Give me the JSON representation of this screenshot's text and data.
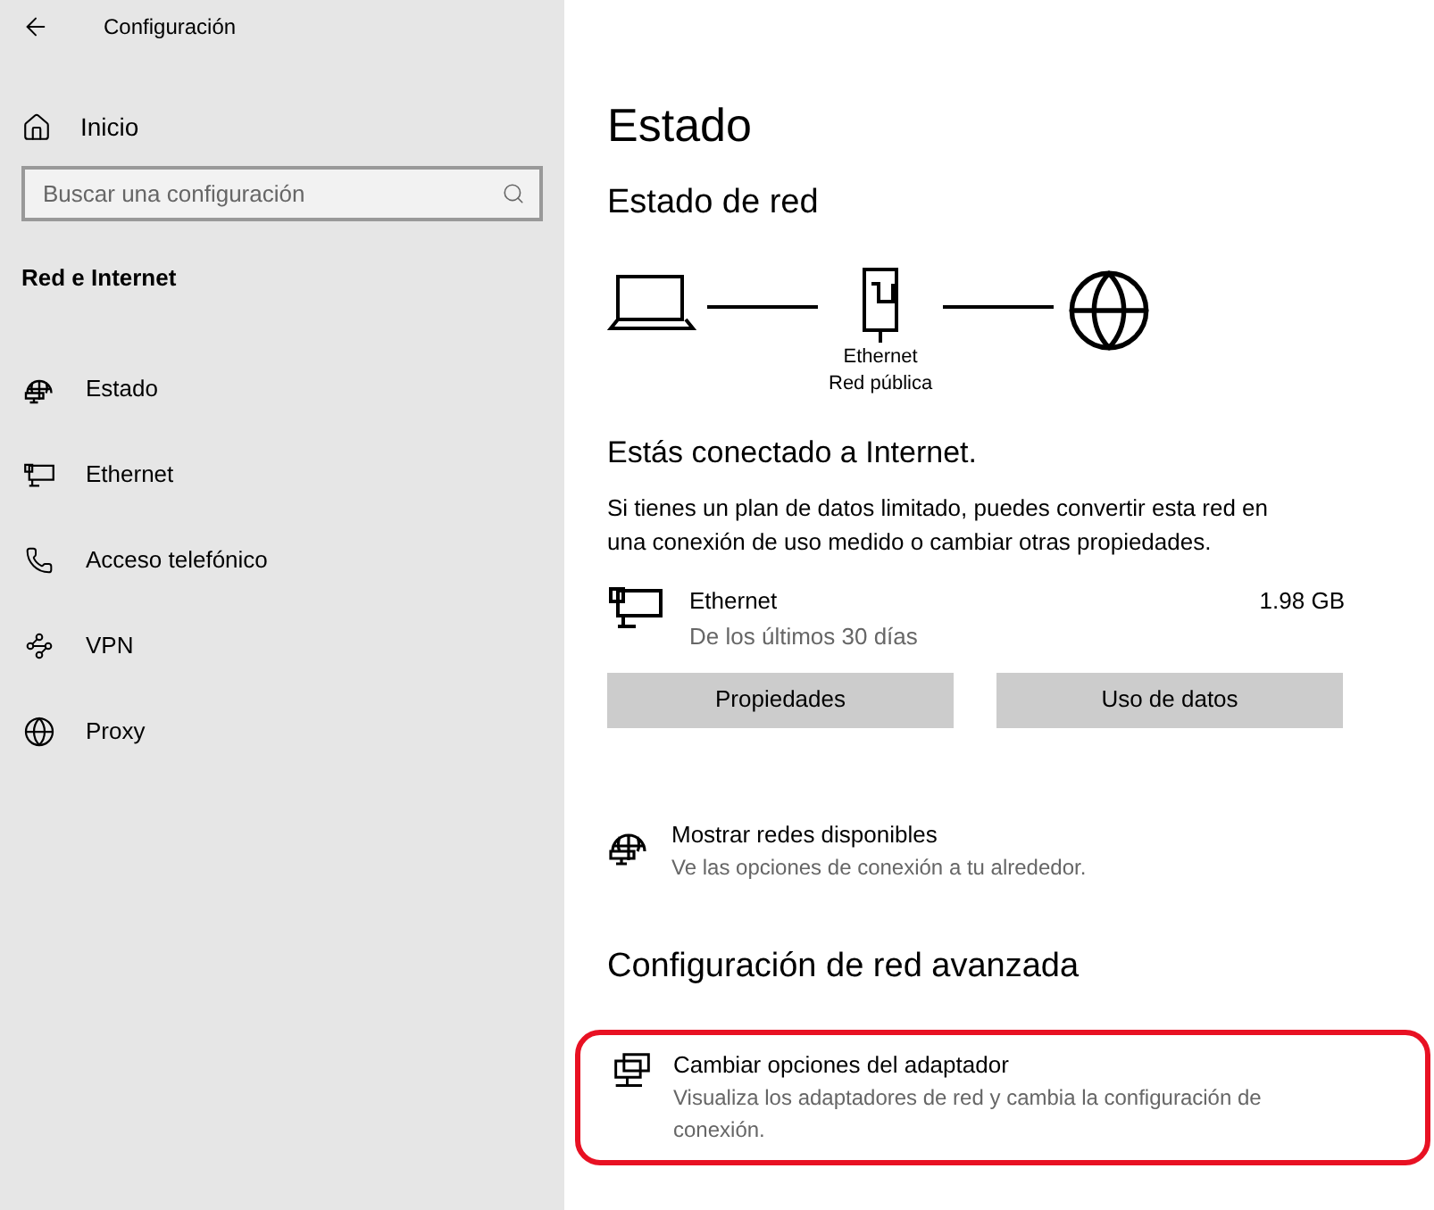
{
  "window": {
    "title": "Configuración"
  },
  "sidebar": {
    "home": "Inicio",
    "search": {
      "placeholder": "Buscar una configuración"
    },
    "section": "Red e Internet",
    "items": [
      {
        "kind": "status",
        "label": "Estado"
      },
      {
        "kind": "ethernet",
        "label": "Ethernet"
      },
      {
        "kind": "dialup",
        "label": "Acceso telefónico"
      },
      {
        "kind": "vpn",
        "label": "VPN"
      },
      {
        "kind": "proxy",
        "label": "Proxy"
      }
    ]
  },
  "main": {
    "title": "Estado",
    "network_heading": "Estado de red",
    "diagram": {
      "adapter": "Ethernet",
      "profile": "Red pública"
    },
    "connected": "Estás conectado a Internet.",
    "description": "Si tienes un plan de datos limitado, puedes convertir esta red en una conexión de uso medido o cambiar otras propiedades.",
    "connection": {
      "name": "Ethernet",
      "period": "De los últimos 30 días",
      "usage": "1.98 GB"
    },
    "buttons": [
      "Propiedades",
      "Uso de datos"
    ],
    "show_networks": {
      "title": "Mostrar redes disponibles",
      "description": "Ve las opciones de conexión a tu alrededor."
    },
    "advanced_heading": "Configuración de red avanzada",
    "advanced_links": [
      {
        "title": "Cambiar opciones del adaptador",
        "description": "Visualiza los adaptadores de red y cambia la configuración de conexión.",
        "highlighted": true
      }
    ]
  }
}
